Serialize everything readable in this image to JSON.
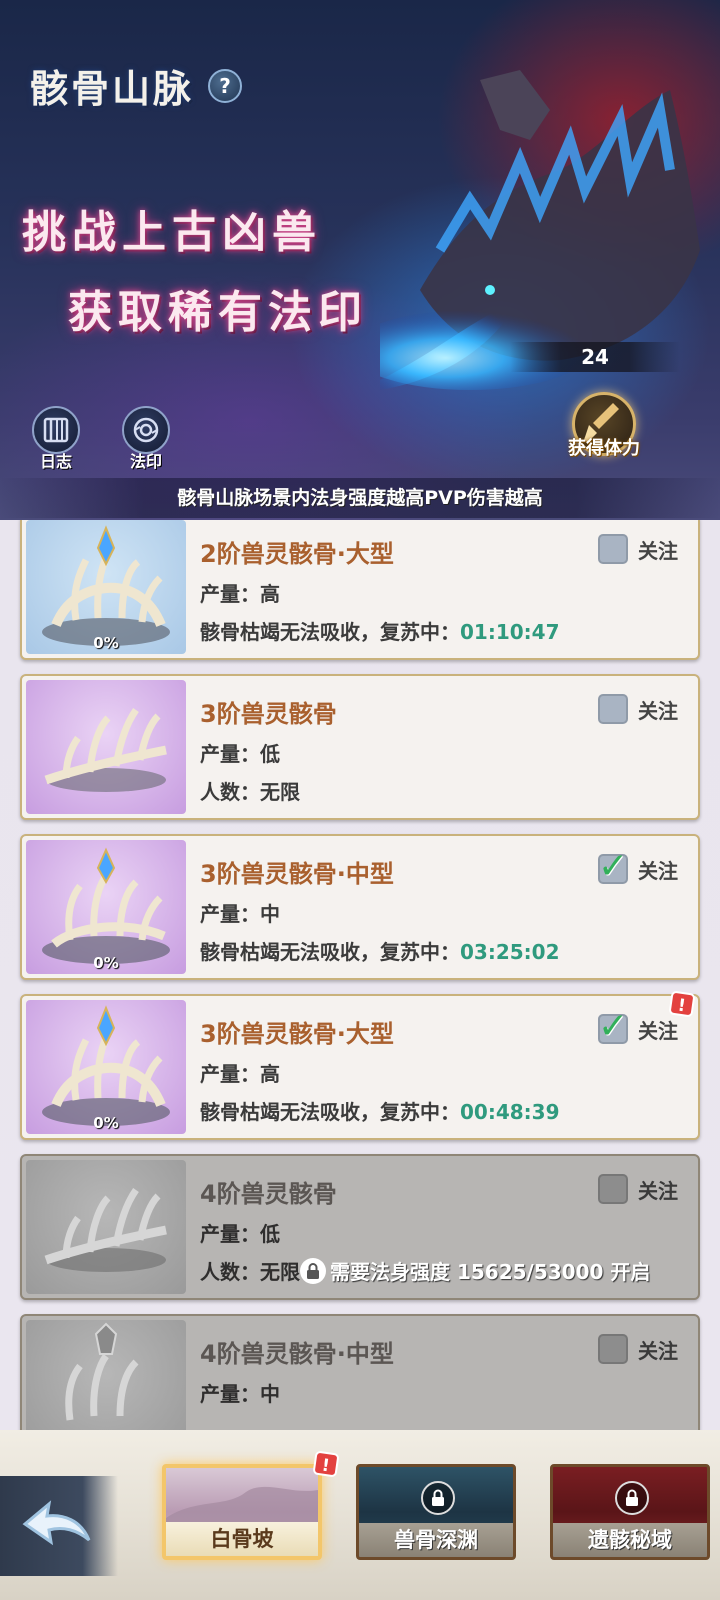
{
  "header": {
    "title": "骸骨山脉",
    "help_icon": "?",
    "slogan_line1": "挑战上古凶兽",
    "slogan_line2": "获取稀有法印",
    "stamina_count": "24",
    "stamina_button_label": "获得体力",
    "side_buttons": [
      {
        "label": "日志",
        "icon": "log-icon"
      },
      {
        "label": "法印",
        "icon": "seal-icon"
      }
    ],
    "info_text": "骸骨山脉场景内法身强度越高PVP伤害越高"
  },
  "cards": [
    {
      "name": "2阶兽灵骸骨·大型",
      "row1": "产量：高",
      "row2_text": "骸骨枯竭无法吸收，复苏中：",
      "timer": "01:10:47",
      "progress": "0%",
      "follow_label": "关注",
      "followed": false,
      "theme": "blue",
      "alert": false
    },
    {
      "name": "3阶兽灵骸骨",
      "row1": "产量：低",
      "row2_text": "人数：无限",
      "timer": "",
      "progress": "",
      "follow_label": "关注",
      "followed": false,
      "theme": "purple",
      "alert": false
    },
    {
      "name": "3阶兽灵骸骨·中型",
      "row1": "产量：中",
      "row2_text": "骸骨枯竭无法吸收，复苏中：",
      "timer": "03:25:02",
      "progress": "0%",
      "follow_label": "关注",
      "followed": true,
      "theme": "purple",
      "alert": false
    },
    {
      "name": "3阶兽灵骸骨·大型",
      "row1": "产量：高",
      "row2_text": "骸骨枯竭无法吸收，复苏中：",
      "timer": "00:48:39",
      "progress": "0%",
      "follow_label": "关注",
      "followed": true,
      "theme": "purple",
      "alert": true
    },
    {
      "name": "4阶兽灵骸骨",
      "row1": "产量：低",
      "row2_text": "人数：无限",
      "timer": "",
      "progress": "",
      "follow_label": "关注",
      "followed": false,
      "theme": "gray",
      "alert": false,
      "lock_text": "需要法身强度 15625/53000 开启"
    },
    {
      "name": "4阶兽灵骸骨·中型",
      "row1": "产量：中",
      "row2_text": "",
      "timer": "",
      "progress": "",
      "follow_label": "关注",
      "followed": false,
      "theme": "gray",
      "alert": false
    }
  ],
  "bottom_nav": {
    "back_icon": "back-arrow-icon",
    "tabs": [
      {
        "label": "白骨坡",
        "active": true,
        "locked": false,
        "alert": "!"
      },
      {
        "label": "兽骨深渊",
        "active": false,
        "locked": true
      },
      {
        "label": "遗骸秘域",
        "active": false,
        "locked": true
      }
    ]
  },
  "colors": {
    "card_title": "#a9602e",
    "timer": "#2f9a7e",
    "check": "#32b05a",
    "alert": "#e3413f",
    "active_tab_glow": "#f3c66a"
  }
}
